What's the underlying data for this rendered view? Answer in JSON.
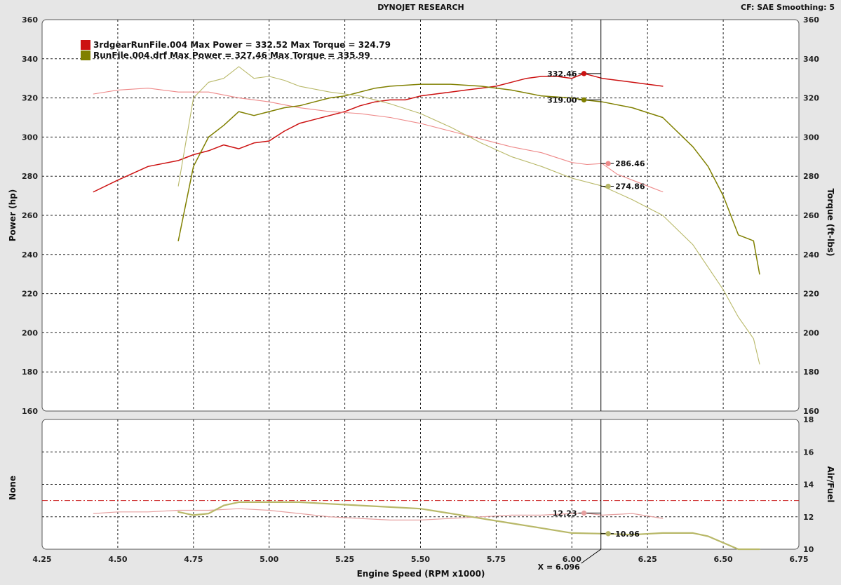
{
  "window": {
    "title": "DYNOJET RESEARCH",
    "settings": "CF: SAE  Smoothing: 5"
  },
  "legend": [
    {
      "label": "3rdgearRunFile.004 Max Power = 332.52 Max Torque = 324.79",
      "color": "#cc1111"
    },
    {
      "label": "RunFile.004.drf Max Power = 327.46 Max Torque = 335.99",
      "color": "#808000"
    }
  ],
  "cursor": {
    "x": 6.096,
    "label": "X = 6.096"
  },
  "chart_data": [
    {
      "type": "line",
      "title": "",
      "xlabel": "Engine Speed (RPM x1000)",
      "ylabel": "Power (hp)",
      "ylabel_right": "Torque (ft-lbs)",
      "xlim": [
        4.25,
        6.75
      ],
      "ylim": [
        160,
        360
      ],
      "ylim_right": [
        160,
        360
      ],
      "xticks": [
        "4.25",
        "4.50",
        "4.75",
        "5.00",
        "5.25",
        "5.50",
        "5.75",
        "6.00",
        "6.25",
        "6.50",
        "6.75"
      ],
      "yticks": [
        "160",
        "180",
        "200",
        "220",
        "240",
        "260",
        "280",
        "300",
        "320",
        "340",
        "360"
      ],
      "grid": true,
      "legend_position": "top-left",
      "series": [
        {
          "name": "3rdgearRunFile.004 Power",
          "role": "power",
          "color": "#cc1111",
          "width": 1.5,
          "x": [
            4.42,
            4.5,
            4.6,
            4.7,
            4.75,
            4.8,
            4.85,
            4.9,
            4.95,
            5.0,
            5.05,
            5.1,
            5.15,
            5.2,
            5.25,
            5.3,
            5.35,
            5.4,
            5.45,
            5.5,
            5.55,
            5.6,
            5.65,
            5.7,
            5.75,
            5.8,
            5.85,
            5.9,
            5.95,
            6.0,
            6.04,
            6.1,
            6.15,
            6.2,
            6.25,
            6.3
          ],
          "y": [
            272,
            278,
            285,
            288,
            291,
            293,
            296,
            294,
            297,
            298,
            303,
            307,
            309,
            311,
            313,
            316,
            318,
            319,
            319,
            321,
            322,
            323,
            324,
            325,
            326,
            328,
            330,
            331,
            331,
            330,
            332.46,
            330,
            329,
            328,
            327,
            326
          ],
          "marker": {
            "x": 6.04,
            "y": 332.46,
            "label": "332.46",
            "side": "left"
          }
        },
        {
          "name": "3rdgearRunFile.004 Torque",
          "role": "torque",
          "color": "#ee8888",
          "width": 1.1,
          "x": [
            4.42,
            4.5,
            4.6,
            4.7,
            4.8,
            4.9,
            5.0,
            5.1,
            5.2,
            5.3,
            5.4,
            5.5,
            5.6,
            5.7,
            5.8,
            5.9,
            6.0,
            6.05,
            6.1,
            6.15,
            6.2,
            6.25,
            6.3
          ],
          "y": [
            322,
            324,
            325,
            323,
            323,
            320,
            318,
            315,
            313,
            312,
            310,
            307,
            303,
            299,
            295,
            292,
            287,
            286,
            286.46,
            281,
            278,
            275,
            272
          ],
          "marker": {
            "x": 6.12,
            "y": 286.46,
            "label": "286.46",
            "side": "right"
          }
        },
        {
          "name": "RunFile.004.drf Power",
          "role": "power",
          "color": "#808000",
          "width": 1.5,
          "x": [
            4.7,
            4.75,
            4.8,
            4.85,
            4.9,
            4.95,
            5.0,
            5.05,
            5.1,
            5.15,
            5.2,
            5.25,
            5.3,
            5.35,
            5.4,
            5.5,
            5.6,
            5.7,
            5.8,
            5.9,
            6.0,
            6.04,
            6.1,
            6.2,
            6.3,
            6.4,
            6.45,
            6.5,
            6.55,
            6.6,
            6.62
          ],
          "y": [
            247,
            285,
            300,
            306,
            313,
            311,
            313,
            315,
            316,
            318,
            320,
            321,
            323,
            325,
            326,
            327,
            327,
            326,
            324,
            321,
            320,
            319,
            318,
            315,
            310,
            295,
            285,
            270,
            250,
            247,
            230
          ],
          "marker": {
            "x": 6.04,
            "y": 319.0,
            "label": "319.00",
            "side": "left"
          }
        },
        {
          "name": "RunFile.004.drf Torque",
          "role": "torque",
          "color": "#b8b868",
          "width": 1.1,
          "x": [
            4.7,
            4.75,
            4.8,
            4.85,
            4.9,
            4.95,
            5.0,
            5.05,
            5.1,
            5.2,
            5.3,
            5.4,
            5.5,
            5.6,
            5.7,
            5.8,
            5.9,
            6.0,
            6.1,
            6.2,
            6.3,
            6.4,
            6.5,
            6.55,
            6.6,
            6.62
          ],
          "y": [
            275,
            320,
            328,
            330,
            336,
            330,
            331,
            329,
            326,
            323,
            321,
            317,
            312,
            305,
            297,
            290,
            285,
            279,
            275,
            268,
            260,
            245,
            222,
            208,
            197,
            184
          ],
          "marker": {
            "x": 6.12,
            "y": 274.86,
            "label": "274.86",
            "side": "right"
          }
        }
      ]
    },
    {
      "type": "line",
      "title": "",
      "xlabel": "Engine Speed (RPM x1000)",
      "ylabel": "None",
      "ylabel_right": "Air/Fuel",
      "xlim": [
        4.25,
        6.75
      ],
      "ylim": [
        10,
        18
      ],
      "yticks_right": [
        "10",
        "12",
        "14",
        "16",
        "18"
      ],
      "grid": true,
      "reference_line": {
        "y": 13,
        "color": "#cc2222"
      },
      "series": [
        {
          "name": "3rdgearRunFile.004 Air/Fuel",
          "color": "#e6a0a0",
          "width": 1.2,
          "x": [
            4.42,
            4.5,
            4.6,
            4.7,
            4.8,
            4.9,
            5.0,
            5.1,
            5.2,
            5.3,
            5.4,
            5.5,
            5.6,
            5.7,
            5.8,
            5.9,
            6.0,
            6.04,
            6.1,
            6.2,
            6.3
          ],
          "y": [
            12.2,
            12.3,
            12.3,
            12.4,
            12.4,
            12.5,
            12.4,
            12.2,
            12.0,
            11.9,
            11.8,
            11.8,
            11.9,
            12.0,
            12.1,
            12.1,
            12.2,
            12.23,
            12.1,
            12.2,
            11.9
          ],
          "marker": {
            "x": 6.04,
            "y": 12.23,
            "label": "12.23",
            "side": "left"
          }
        },
        {
          "name": "RunFile.004.drf Air/Fuel",
          "color": "#b8b868",
          "width": 2.2,
          "x": [
            4.7,
            4.75,
            4.8,
            4.85,
            4.9,
            4.95,
            5.0,
            5.1,
            5.2,
            5.3,
            5.4,
            5.5,
            5.6,
            5.7,
            5.8,
            5.9,
            6.0,
            6.1,
            6.2,
            6.3,
            6.4,
            6.45,
            6.5,
            6.55,
            6.6,
            6.62
          ],
          "y": [
            12.3,
            12.1,
            12.2,
            12.7,
            12.9,
            12.9,
            12.9,
            12.9,
            12.8,
            12.7,
            12.6,
            12.5,
            12.2,
            11.9,
            11.6,
            11.3,
            11.0,
            10.96,
            10.9,
            11.0,
            11.0,
            10.8,
            10.4,
            10.0,
            10.0,
            10.0
          ],
          "marker": {
            "x": 6.12,
            "y": 10.96,
            "label": "10.96",
            "side": "right"
          }
        }
      ]
    }
  ]
}
